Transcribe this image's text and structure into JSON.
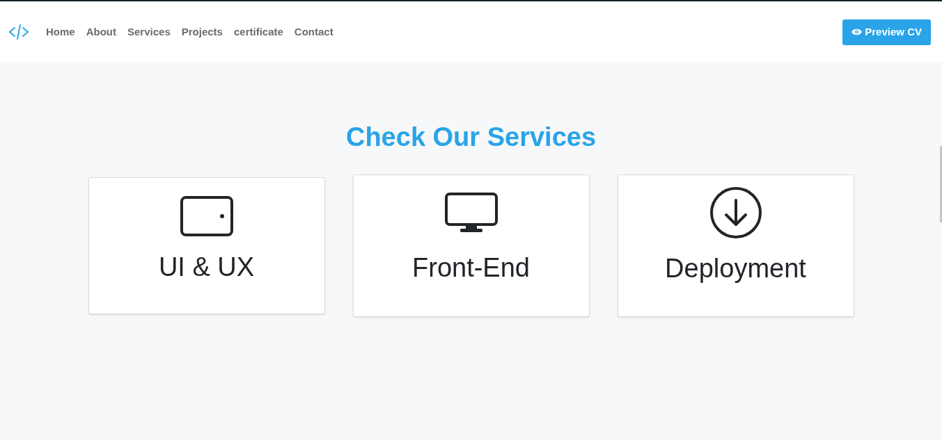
{
  "nav": {
    "links": [
      "Home",
      "About",
      "Services",
      "Projects",
      "certificate",
      "Contact"
    ],
    "button": "Preview CV"
  },
  "section": {
    "title": "Check Our Services",
    "cards": [
      {
        "kind": "tablet",
        "title": "UI & UX",
        "raised": false
      },
      {
        "kind": "monitor",
        "title": "Front-End",
        "raised": true
      },
      {
        "kind": "download",
        "title": "Deployment",
        "raised": true
      }
    ]
  }
}
